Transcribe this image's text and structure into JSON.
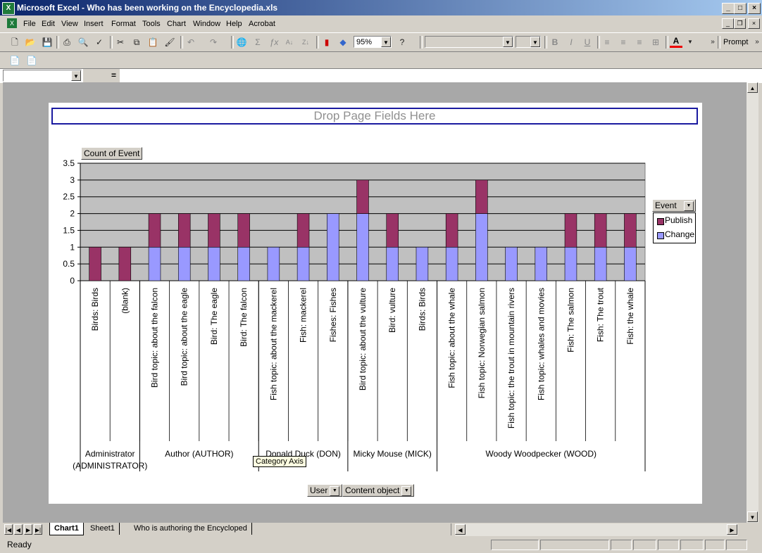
{
  "window": {
    "title": "Microsoft Excel - Who has been working on the Encyclopedia.xls",
    "app_icon": "excel-icon"
  },
  "menu": [
    "File",
    "Edit",
    "View",
    "Insert",
    "Format",
    "Tools",
    "Chart",
    "Window",
    "Help",
    "Acrobat"
  ],
  "toolbar": {
    "zoom": "95%",
    "prompt_label": "Prompt",
    "font_name": "",
    "font_size": ""
  },
  "formula_bar": {
    "name_box": "",
    "equals": "="
  },
  "chart": {
    "drop_zone": "Drop Page Fields Here",
    "data_field_button": "Count of Event",
    "legend_title": "Event",
    "row_field_buttons": [
      "User",
      "Content object"
    ],
    "tooltip": "Category Axis"
  },
  "chart_data": {
    "type": "bar",
    "stacked": true,
    "ylim": [
      0,
      3.5
    ],
    "yticks": [
      "0",
      "0.5",
      "1",
      "1.5",
      "2",
      "2.5",
      "3",
      "3.5"
    ],
    "categories": [
      "Birds: Birds",
      "(blank)",
      "Bird topic: about the falcon",
      "Bird topic: about the eagle",
      "Bird: The eagle",
      "Bird: The falcon",
      "Fish topic: about the mackerel",
      "Fish: mackerel",
      "Fishes: Fishes",
      "Bird topic: about the vulture",
      "Bird: vulture",
      "Birds: Birds",
      "Fish topic: about the whale",
      "Fish topic: Norwegian salmon",
      "Fish topic: the trout in mountain rivers",
      "Fish topic: whales and movies",
      "Fish: The salmon",
      "Fish: The trout",
      "Fish: the whale"
    ],
    "groups": [
      {
        "label": "Administrator (ADMINISTRATOR)",
        "start": 0,
        "count": 2
      },
      {
        "label": "Author (AUTHOR)",
        "start": 2,
        "count": 4
      },
      {
        "label": "Donald Duck (DON)",
        "start": 6,
        "count": 3
      },
      {
        "label": "Micky Mouse (MICK)",
        "start": 9,
        "count": 3
      },
      {
        "label": "Woody Woodpecker (WOOD)",
        "start": 12,
        "count": 7
      }
    ],
    "series": [
      {
        "name": "Change",
        "color": "#9999ff",
        "values": [
          0,
          0,
          1,
          1,
          1,
          1,
          1,
          1,
          2,
          2,
          1,
          1,
          1,
          2,
          1,
          1,
          1,
          1,
          1
        ]
      },
      {
        "name": "Publish",
        "color": "#993366",
        "values": [
          1,
          1,
          1,
          1,
          1,
          1,
          0,
          1,
          0,
          1,
          1,
          0,
          1,
          1,
          0,
          0,
          1,
          1,
          1
        ]
      }
    ],
    "legend_order": [
      "Publish",
      "Change"
    ],
    "plot_bg": "#c0c0c0",
    "grid": true,
    "legend": "right"
  },
  "sheet_tabs": [
    "Chart1",
    "Sheet1",
    "Who is authoring the Encycloped"
  ],
  "status": "Ready"
}
